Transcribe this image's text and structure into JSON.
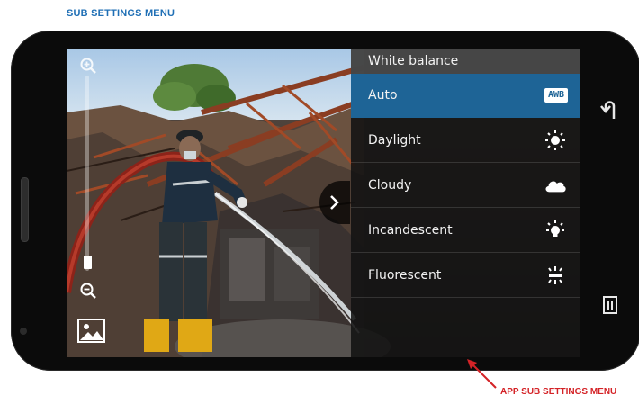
{
  "captions": {
    "top": "SUB SETTINGS MENU",
    "bottom": "APP SUB SETTINGS MENU"
  },
  "camera": {
    "zoom_in_icon": "zoom-in-icon",
    "zoom_out_icon": "zoom-out-icon",
    "zoom_level": 0.1,
    "gallery_icon": "gallery-thumbnail-icon",
    "panel_toggle_icon": "chevron-right-icon"
  },
  "white_balance": {
    "title": "White balance",
    "selected_index": 0,
    "options": [
      {
        "label": "Auto",
        "icon": "awb-icon",
        "badge": "AWB"
      },
      {
        "label": "Daylight",
        "icon": "sun-icon"
      },
      {
        "label": "Cloudy",
        "icon": "cloud-icon"
      },
      {
        "label": "Incandescent",
        "icon": "bulb-icon"
      },
      {
        "label": "Fluorescent",
        "icon": "fluorescent-icon"
      }
    ]
  },
  "nav_bar": {
    "back_icon": "back-icon",
    "recent_apps_icon": "recent-apps-icon"
  },
  "colors": {
    "accent": "#1e6496",
    "caption_top": "#1f6fb5",
    "caption_bottom": "#d42327",
    "device": "#0b0b0b"
  }
}
